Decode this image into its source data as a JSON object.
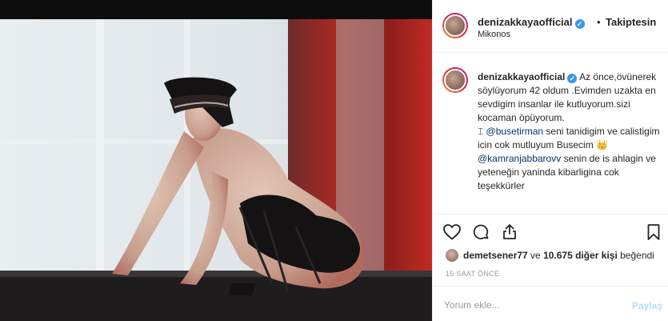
{
  "post": {
    "username": "denizakkayaofficial",
    "verified_icon": "verified-badge-icon",
    "separator": "•",
    "follow_status": "Takiptesin",
    "location": "Mikonos"
  },
  "caption": {
    "username": "denizakkayaofficial",
    "line1": "Az önce,övünerek söylüyorum 42 oldum .Evimden uzakta en sevdigim insanlar ile kutluyorum.sizi kocaman öpüyorum.",
    "mention1_prefix": "⌶ ",
    "mention1": "@busetirman",
    "line2": " seni tanidigim ve calistigim icin cok mutluyum Busecim 👑",
    "mention2": "@kamranjabbarovv",
    "line3": " senin de is ahlagin ve yeteneğin yaninda kibarligina cok teşekkürler"
  },
  "actions": {
    "like_icon": "heart-icon",
    "comment_icon": "comment-bubble-icon",
    "share_icon": "share-icon",
    "save_icon": "bookmark-icon"
  },
  "likes": {
    "first_liker": "demetsener77",
    "connector": " ve ",
    "others": "10.675 diğer kişi",
    "suffix": " beğendi"
  },
  "timestamp": "15 SAAT ÖNCE",
  "comment": {
    "placeholder": "Yorum ekle...",
    "post_label": "Paylaş"
  },
  "colors": {
    "verified": "#3897f0",
    "mention": "#003569",
    "post_disabled": "#b2dffc"
  }
}
